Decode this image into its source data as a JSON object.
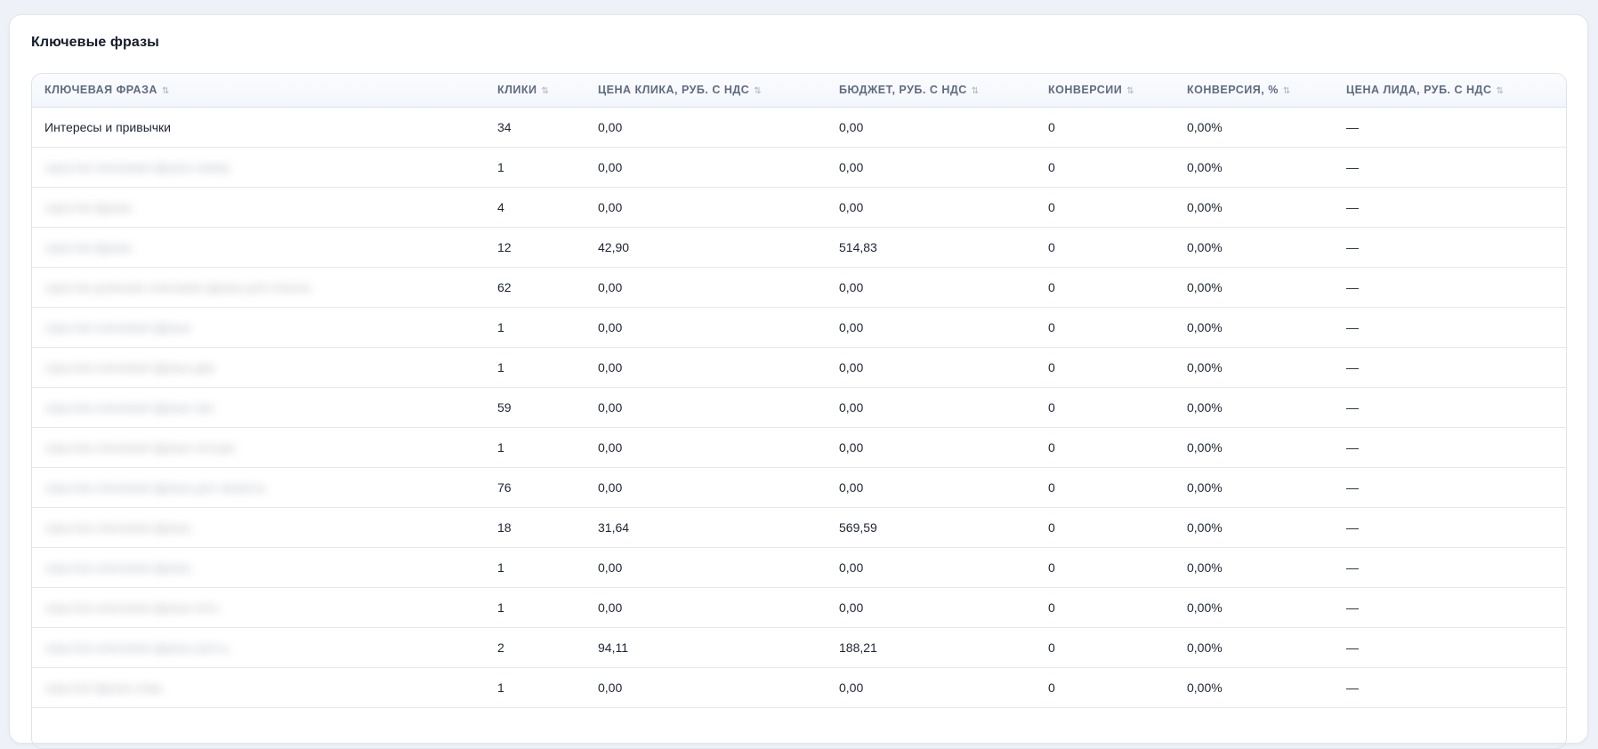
{
  "section": {
    "title": "Ключевые фразы"
  },
  "table": {
    "sort_icon": "⇅",
    "columns": [
      "КЛЮЧЕВАЯ ФРАЗА",
      "КЛИКИ",
      "ЦЕНА КЛИКА, РУБ. С НДС",
      "БЮДЖЕТ, РУБ. С НДС",
      "КОНВЕРСИИ",
      "КОНВЕРСИЯ, %",
      "ЦЕНА ЛИДА, РУБ. С НДС"
    ],
    "rows": [
      {
        "phrase": "Интересы и привычки",
        "blurred": false,
        "clicks": "34",
        "cpc": "0,00",
        "budget": "0,00",
        "conversions": "0",
        "conv_rate": "0,00%",
        "lead_price": "—"
      },
      {
        "phrase": "скрытая ключевая фраза номер",
        "blurred": true,
        "clicks": "1",
        "cpc": "0,00",
        "budget": "0,00",
        "conversions": "0",
        "conv_rate": "0,00%",
        "lead_price": "—"
      },
      {
        "phrase": "скрытая фраза",
        "blurred": true,
        "clicks": "4",
        "cpc": "0,00",
        "budget": "0,00",
        "conversions": "0",
        "conv_rate": "0,00%",
        "lead_price": "—"
      },
      {
        "phrase": "скрытая фраза",
        "blurred": true,
        "clicks": "12",
        "cpc": "42,90",
        "budget": "514,83",
        "conversions": "0",
        "conv_rate": "0,00%",
        "lead_price": "—"
      },
      {
        "phrase": "скрытая длинная ключевая фраза для поиска",
        "blurred": true,
        "clicks": "62",
        "cpc": "0,00",
        "budget": "0,00",
        "conversions": "0",
        "conv_rate": "0,00%",
        "lead_price": "—"
      },
      {
        "phrase": "скрытая ключевая фраза",
        "blurred": true,
        "clicks": "1",
        "cpc": "0,00",
        "budget": "0,00",
        "conversions": "0",
        "conv_rate": "0,00%",
        "lead_price": "—"
      },
      {
        "phrase": "скрытая ключевая фраза два",
        "blurred": true,
        "clicks": "1",
        "cpc": "0,00",
        "budget": "0,00",
        "conversions": "0",
        "conv_rate": "0,00%",
        "lead_price": "—"
      },
      {
        "phrase": "скрытая ключевая фраза три",
        "blurred": true,
        "clicks": "59",
        "cpc": "0,00",
        "budget": "0,00",
        "conversions": "0",
        "conv_rate": "0,00%",
        "lead_price": "—"
      },
      {
        "phrase": "скрытая ключевая фраза четыре",
        "blurred": true,
        "clicks": "1",
        "cpc": "0,00",
        "budget": "0,00",
        "conversions": "0",
        "conv_rate": "0,00%",
        "lead_price": "—"
      },
      {
        "phrase": "скрытая ключевая фраза для запроса",
        "blurred": true,
        "clicks": "76",
        "cpc": "0,00",
        "budget": "0,00",
        "conversions": "0",
        "conv_rate": "0,00%",
        "lead_price": "—"
      },
      {
        "phrase": "скрытая ключевая фраза",
        "blurred": true,
        "clicks": "18",
        "cpc": "31,64",
        "budget": "569,59",
        "conversions": "0",
        "conv_rate": "0,00%",
        "lead_price": "—"
      },
      {
        "phrase": "скрытая ключевая фраза",
        "blurred": true,
        "clicks": "1",
        "cpc": "0,00",
        "budget": "0,00",
        "conversions": "0",
        "conv_rate": "0,00%",
        "lead_price": "—"
      },
      {
        "phrase": "скрытая ключевая фраза пять",
        "blurred": true,
        "clicks": "1",
        "cpc": "0,00",
        "budget": "0,00",
        "conversions": "0",
        "conv_rate": "0,00%",
        "lead_price": "—"
      },
      {
        "phrase": "скрытая ключевая фраза шесть",
        "blurred": true,
        "clicks": "2",
        "cpc": "94,11",
        "budget": "188,21",
        "conversions": "0",
        "conv_rate": "0,00%",
        "lead_price": "—"
      },
      {
        "phrase": "скрытая фраза семь",
        "blurred": true,
        "clicks": "1",
        "cpc": "0,00",
        "budget": "0,00",
        "conversions": "0",
        "conv_rate": "0,00%",
        "lead_price": "—"
      }
    ]
  }
}
